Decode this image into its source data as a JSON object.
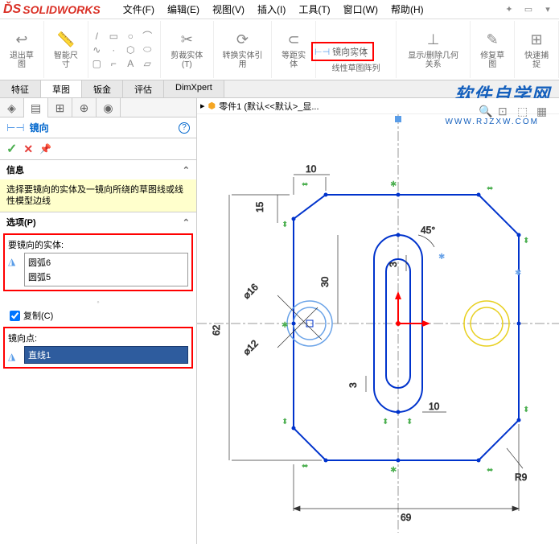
{
  "app": {
    "name": "SOLIDWORKS"
  },
  "menu": {
    "items": [
      "文件(F)",
      "编辑(E)",
      "视图(V)",
      "插入(I)",
      "工具(T)",
      "窗口(W)",
      "帮助(H)"
    ]
  },
  "ribbon": {
    "exit_sketch": "退出草图",
    "smart_dim": "智能尺寸",
    "trim": "剪裁实体(T)",
    "convert": "转换实体引用",
    "offset": "等距实体",
    "mirror": "镜向实体",
    "linear_pattern": "线性草图阵列",
    "display_delete": "显示/删除几何关系",
    "repair": "修复草图",
    "quick_snap": "快速捕捉"
  },
  "tabs": {
    "items": [
      "特征",
      "草图",
      "钣金",
      "评估",
      "DimXpert"
    ],
    "active": 1
  },
  "panel": {
    "feature_name": "镜向",
    "info_header": "信息",
    "info_text": "选择要镜向的实体及一镜向所绕的草图线或线性模型边线",
    "options_header": "选项(P)",
    "entities_label": "要镜向的实体:",
    "entities": [
      "圆弧6",
      "圆弧5"
    ],
    "copy_label": "复制(C)",
    "copy_checked": true,
    "mirror_point_label": "镜向点:",
    "mirror_point_value": "直线1"
  },
  "canvas": {
    "doc_name": "零件1 (默认<<默认>_显...",
    "watermark": "软件自学网",
    "watermark_url": "WWW.RJZXW.COM"
  },
  "chart_data": {
    "type": "sketch",
    "dimensions": {
      "width_top": 10,
      "height_left_upper": 15,
      "overall_height": 62,
      "dia_outer": 16,
      "dia_inner": 12,
      "slot_half": 30,
      "chamfer_angle": 45,
      "chamfer_len": 3,
      "slot_gap": 3,
      "width_bottom_offset": 10,
      "overall_width": 69,
      "fillet_radius": 9
    }
  }
}
